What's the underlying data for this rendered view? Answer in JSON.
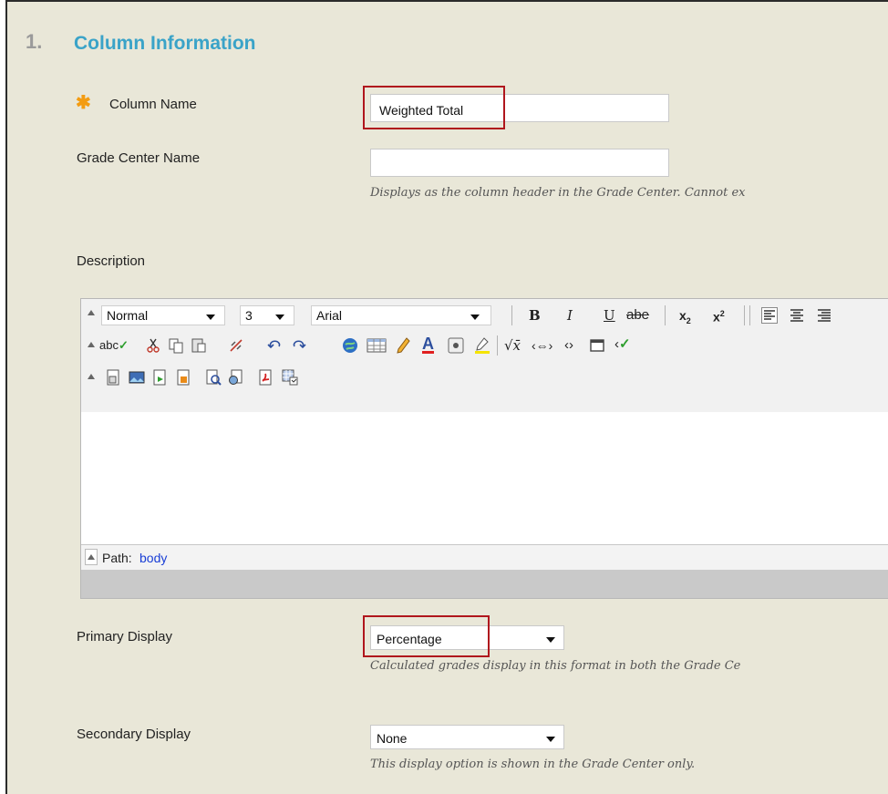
{
  "section": {
    "number": "1.",
    "title": "Column Information"
  },
  "column_name": {
    "label": "Column Name",
    "value": "Weighted Total"
  },
  "grade_center_name": {
    "label": "Grade Center Name",
    "value": "",
    "hint": "Displays as the column header in the Grade Center. Cannot ex"
  },
  "description": {
    "label": "Description"
  },
  "editor": {
    "format_select": "Normal",
    "size_select": "3",
    "font_select": "Arial",
    "bold": "B",
    "italic": "I",
    "underline": "U",
    "strike": "abe",
    "spellcheck": "abc",
    "path_label": "Path:",
    "path_value": "body"
  },
  "primary_display": {
    "label": "Primary Display",
    "value": "Percentage",
    "hint": "Calculated grades display in this format in both the Grade Ce"
  },
  "secondary_display": {
    "label": "Secondary Display",
    "value": "None",
    "hint": "This display option is shown in the Grade Center only."
  },
  "colors": {
    "accent": "#3aa3c8",
    "required": "#f39c12",
    "highlight": "#b0161d",
    "link": "#1a3fd6"
  }
}
